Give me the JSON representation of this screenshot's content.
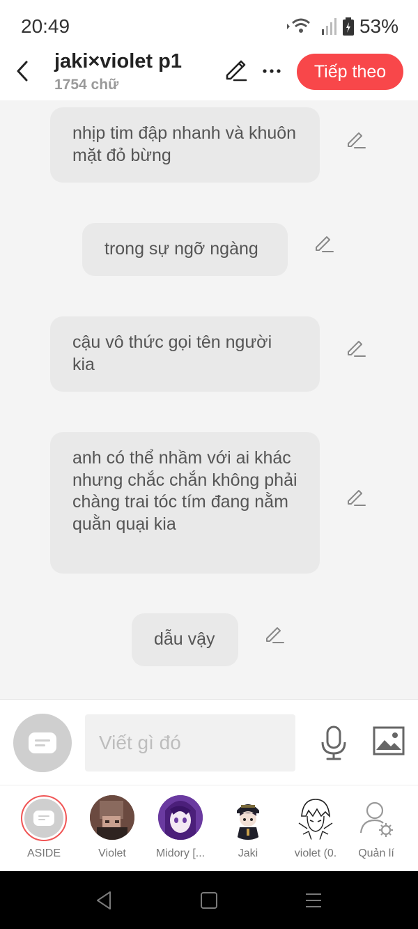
{
  "status_bar": {
    "time": "20:49",
    "battery": "53%"
  },
  "header": {
    "title": "jaki×violet p1",
    "word_count": "1754 chữ",
    "next_label": "Tiếp theo"
  },
  "messages": [
    {
      "text": "nhịp tim đập nhanh và khuôn mặt đỏ bừng"
    },
    {
      "text": "trong sự ngỡ ngàng"
    },
    {
      "text": "cậu vô thức gọi tên người kia"
    },
    {
      "text": "anh có thể nhầm với ai khác nhưng chắc chắn không phải chàng trai tóc tím đang nằm quằn quại kia"
    },
    {
      "text": "dẫu vậy"
    }
  ],
  "composer": {
    "placeholder": "Viết gì đó"
  },
  "characters": [
    {
      "name": "ASIDE"
    },
    {
      "name": "Violet"
    },
    {
      "name": "Midory [..."
    },
    {
      "name": "Jaki"
    },
    {
      "name": "violet (0."
    },
    {
      "name": "Quản lí"
    }
  ],
  "colors": {
    "accent": "#f8474a",
    "bubble": "#e9e9e9",
    "chat_background": "#f4f4f4"
  }
}
